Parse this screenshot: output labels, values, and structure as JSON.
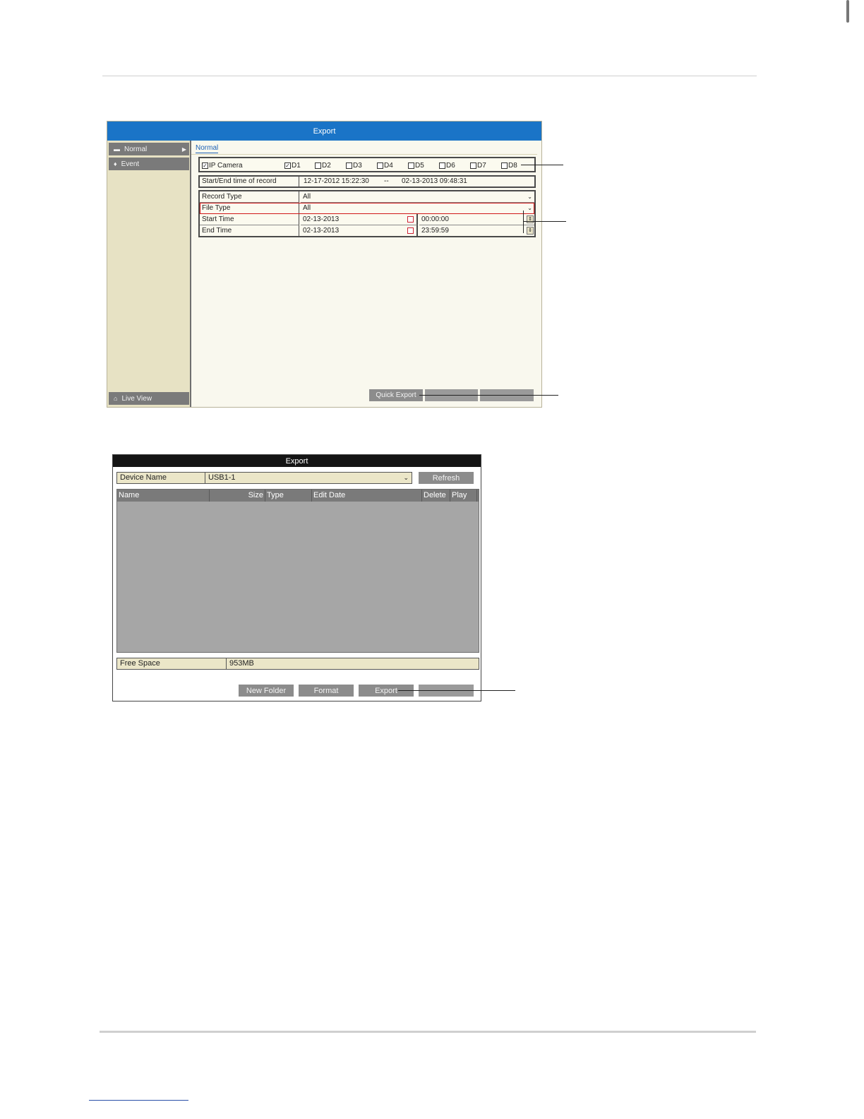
{
  "screen1": {
    "title": "Export",
    "sidebar": {
      "items": [
        {
          "label": "Normal"
        },
        {
          "label": "Event"
        }
      ],
      "bottom_label": "Live View"
    },
    "tab_label": "Normal",
    "camera_row": {
      "group_label": "IP Camera",
      "channels": [
        "D1",
        "D2",
        "D3",
        "D4",
        "D5",
        "D6",
        "D7",
        "D8"
      ],
      "checked": [
        "IP Camera",
        "D1"
      ]
    },
    "record_range": {
      "label": "Start/End time of record",
      "start": "12-17-2012 15:22:30",
      "separator": "--",
      "end": "02-13-2013 09:48:31"
    },
    "form": {
      "record_type": {
        "label": "Record Type",
        "value": "All"
      },
      "file_type": {
        "label": "File Type",
        "value": "All"
      },
      "start_time": {
        "label": "Start Time",
        "date": "02-13-2013",
        "time": "00:00:00"
      },
      "end_time": {
        "label": "End Time",
        "date": "02-13-2013",
        "time": "23:59:59"
      }
    },
    "buttons": {
      "quick_export": "Quick Export"
    }
  },
  "screen2": {
    "title": "Export",
    "device_name": {
      "label": "Device Name",
      "value": "USB1-1"
    },
    "refresh_label": "Refresh",
    "table_headers": {
      "name": "Name",
      "size": "Size",
      "type": "Type",
      "edit_date": "Edit Date",
      "delete": "Delete",
      "play": "Play"
    },
    "free_space": {
      "label": "Free Space",
      "value": "953MB"
    },
    "buttons": {
      "new_folder": "New Folder",
      "format": "Format",
      "export": "Export"
    }
  },
  "colors": {
    "title_bar_blue": "#1a74c7",
    "panel_beige": "#ebe6c8",
    "button_gray": "#8c8c8c",
    "highlight_red": "#d01818"
  }
}
